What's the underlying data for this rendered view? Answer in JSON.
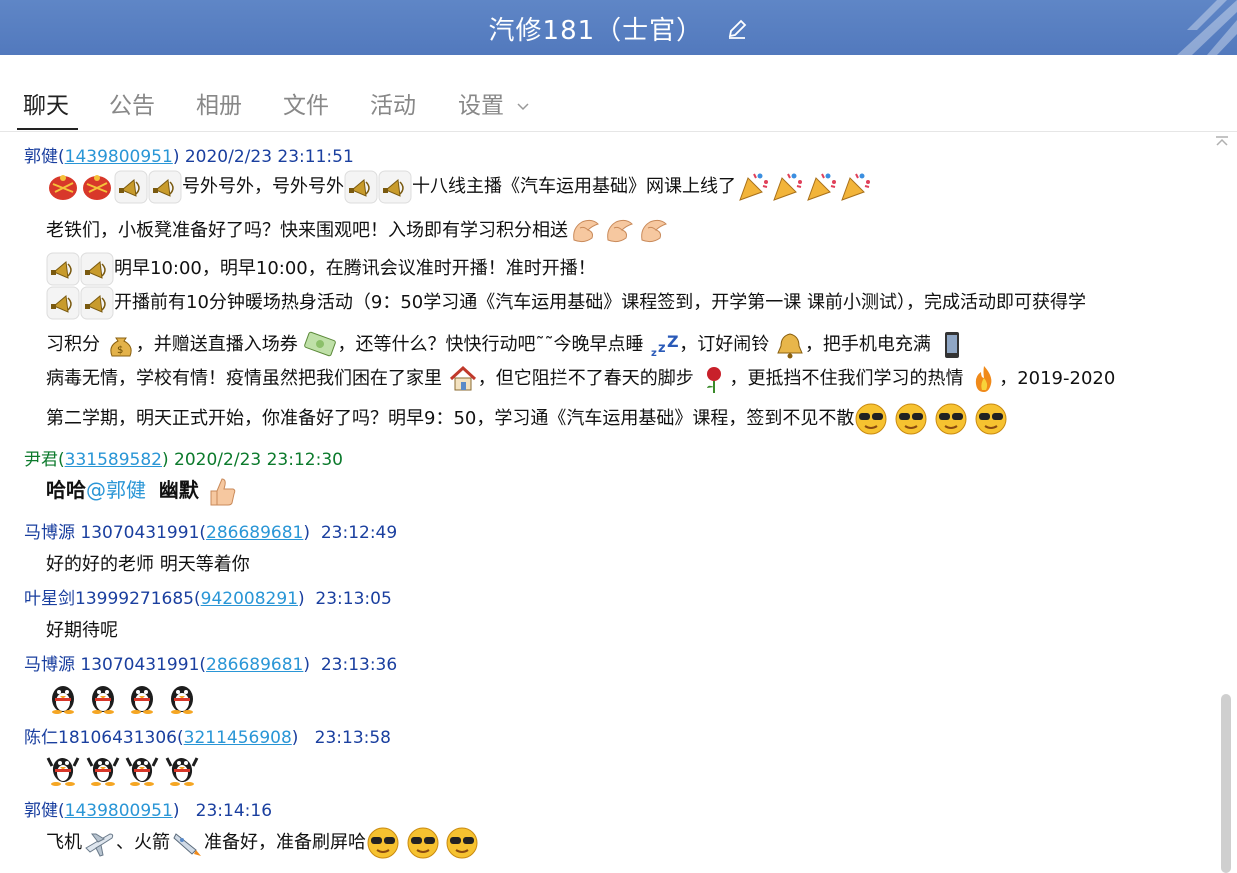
{
  "window": {
    "title": "汽修181（士官）"
  },
  "tabs": [
    {
      "label": "聊天",
      "active": true
    },
    {
      "label": "公告",
      "active": false
    },
    {
      "label": "相册",
      "active": false
    },
    {
      "label": "文件",
      "active": false
    },
    {
      "label": "活动",
      "active": false
    },
    {
      "label": "设置",
      "active": false
    }
  ],
  "messages": {
    "m1": {
      "name": "郭健",
      "qq": "1439800951",
      "time": "2020/2/23 23:11:51",
      "l1": "号外号外，号外号外",
      "l1b": "十八线主播《汽车运用基础》网课上线了",
      "l2": "老铁们，小板凳准备好了吗？快来围观吧！入场即有学习积分相送",
      "l3": "明早10:00，明早10:00，在腾讯会议准时开播！准时开播！",
      "l4": "开播前有10分钟暖场热身活动（9：50学习通《汽车运用基础》课程签到，开学第一课 课前小测试），完成活动即可获得学",
      "l5a": "习积分",
      "l5b": "，并赠送直播入场券",
      "l5c": "，还等什么？快快行动吧˜˜今晚早点睡",
      "l5d": "，订好闹铃",
      "l5e": "，把手机电充满",
      "l6a": "病毒无情，学校有情！疫情虽然把我们困在了家里",
      "l6b": "，但它阻拦不了春天的脚步",
      "l6c": "，更抵挡不住我们学习的热情",
      "l6d": "，2019-2020",
      "l7": "第二学期，明天正式开始，你准备好了吗？明早9：50，学习通《汽车运用基础》课程，签到不见不散"
    },
    "m2": {
      "name": "尹君",
      "qq": "331589582",
      "time": "2020/2/23 23:12:30",
      "text1": "哈哈",
      "at": "@郭健",
      "text2": "幽默"
    },
    "m3": {
      "name": "马博源 13070431991",
      "qq": "286689681",
      "time": "23:12:49",
      "text": "好的好的老师  明天等着你"
    },
    "m4": {
      "name": "叶星剑13999271685",
      "qq": "942008291",
      "time": "23:13:05",
      "text": "好期待呢"
    },
    "m5": {
      "name": "马博源 13070431991",
      "qq": "286689681",
      "time": "23:13:36"
    },
    "m6": {
      "name": "陈仁18106431306",
      "qq": "3211456908",
      "time": "23:13:58"
    },
    "m7": {
      "name": "郭健",
      "qq": "1439800951",
      "time": "23:14:16",
      "a": "飞机",
      "b": "、火箭",
      "c": "准备好，准备刷屏哈"
    }
  },
  "colors": {
    "titlebar": "#5279bd",
    "name": "#1a3f9f",
    "name_green": "#0c7a2c",
    "qq_link": "#2a96d6"
  },
  "icons": [
    "edit-icon",
    "firecracker-icon",
    "horn-icon",
    "party-popper-icon",
    "clap-hand-icon",
    "money-bag-icon",
    "banknote-icon",
    "sleep-zzz-icon",
    "bell-icon",
    "phone-icon",
    "house-icon",
    "rose-icon",
    "fire-icon",
    "cool-face-icon",
    "thumbs-up-icon",
    "penguin-icon",
    "dancing-penguin-icon",
    "airplane-icon",
    "rocket-icon"
  ]
}
